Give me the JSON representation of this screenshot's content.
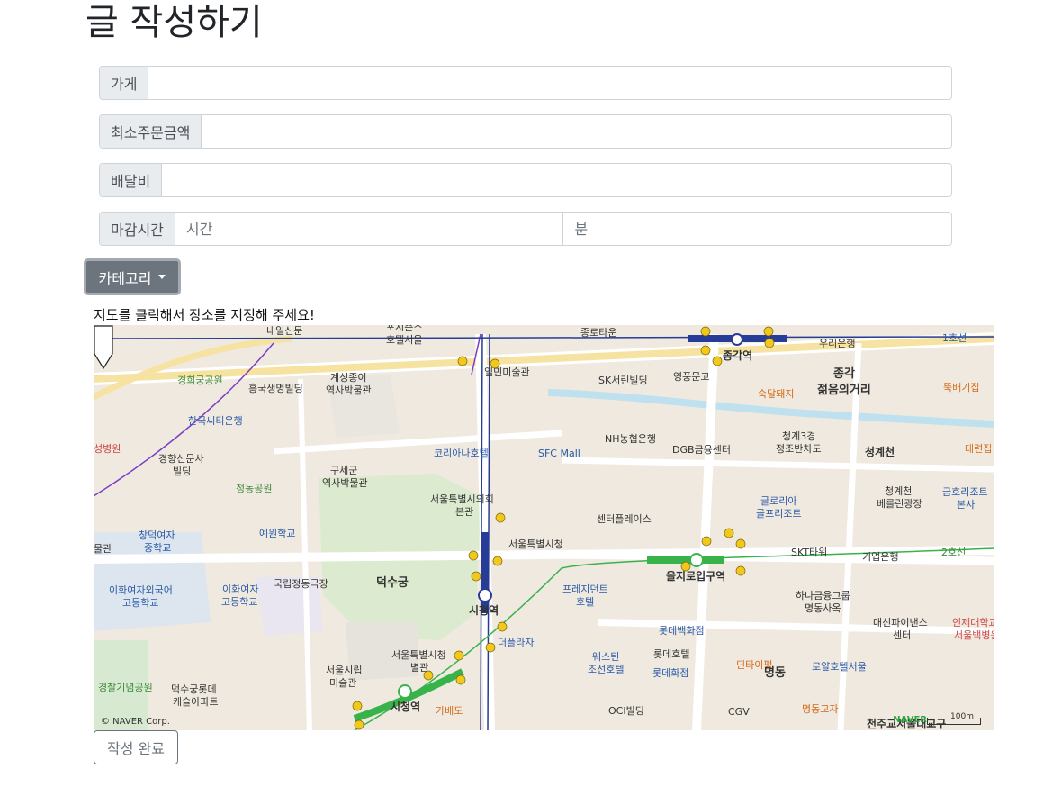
{
  "page": {
    "title": "글 작성하기"
  },
  "form": {
    "store": {
      "label": "가게",
      "value": ""
    },
    "min_order": {
      "label": "최소주문금액",
      "value": ""
    },
    "delivery_fee": {
      "label": "배달비",
      "value": ""
    },
    "deadline": {
      "label": "마감시간",
      "hour_placeholder": "시간",
      "minute_placeholder": "분"
    },
    "category_button": "카테고리",
    "map_hint": "지도를 클릭해서 장소를 지정해 주세요!",
    "submit_label": "작성 완료"
  },
  "map": {
    "copyright": "© NAVER Corp.",
    "logo": "NAVER",
    "scale": "100m",
    "labels": [
      {
        "text": "내일신문",
        "style": ""
      },
      {
        "text": "포시즌스",
        "style": ""
      },
      {
        "text": "호텔서울",
        "style": ""
      },
      {
        "text": "종로타운",
        "style": ""
      },
      {
        "text": "종각역",
        "style": "bold"
      },
      {
        "text": "우리은행",
        "style": ""
      },
      {
        "text": "1호선",
        "style": "blue"
      },
      {
        "text": "일민미술관",
        "style": ""
      },
      {
        "text": "경희궁공원",
        "style": "green"
      },
      {
        "text": "계성종이",
        "style": ""
      },
      {
        "text": "역사박물관",
        "style": ""
      },
      {
        "text": "흥국생명빌딩",
        "style": ""
      },
      {
        "text": "SK서린빌딩",
        "style": ""
      },
      {
        "text": "영풍문고",
        "style": ""
      },
      {
        "text": "숙달돼지",
        "style": "orange"
      },
      {
        "text": "종각",
        "style": "big"
      },
      {
        "text": "젊음의거리",
        "style": "big"
      },
      {
        "text": "뚝배기집",
        "style": "orange"
      },
      {
        "text": "한국씨티은행",
        "style": "blue"
      },
      {
        "text": "NH농협은행",
        "style": ""
      },
      {
        "text": "청계3경",
        "style": ""
      },
      {
        "text": "정조반차도",
        "style": ""
      },
      {
        "text": "성병원",
        "style": "red"
      },
      {
        "text": "코리아나호텔",
        "style": "blue"
      },
      {
        "text": "SFC Mall",
        "style": "blue"
      },
      {
        "text": "DGB금융센터",
        "style": ""
      },
      {
        "text": "청계천",
        "style": "bold"
      },
      {
        "text": "대련집",
        "style": "orange"
      },
      {
        "text": "경향신문사",
        "style": ""
      },
      {
        "text": "빌딩",
        "style": ""
      },
      {
        "text": "구세군",
        "style": ""
      },
      {
        "text": "역사박물관",
        "style": ""
      },
      {
        "text": "정동공원",
        "style": "green"
      },
      {
        "text": "서울특별시의회",
        "style": ""
      },
      {
        "text": "본관",
        "style": ""
      },
      {
        "text": "글로리아",
        "style": "blue"
      },
      {
        "text": "골프리조트",
        "style": "blue"
      },
      {
        "text": "청계천",
        "style": ""
      },
      {
        "text": "베를린광장",
        "style": ""
      },
      {
        "text": "금호리조트",
        "style": "blue"
      },
      {
        "text": "본사",
        "style": "blue"
      },
      {
        "text": "창덕여자",
        "style": "blue"
      },
      {
        "text": "중학교",
        "style": "blue"
      },
      {
        "text": "예원학교",
        "style": "blue"
      },
      {
        "text": "센터플레이스",
        "style": ""
      },
      {
        "text": "서울특별시청",
        "style": ""
      },
      {
        "text": "SKT타워",
        "style": ""
      },
      {
        "text": "기업은행",
        "style": ""
      },
      {
        "text": "2호선",
        "style": "green"
      },
      {
        "text": "물관",
        "style": ""
      },
      {
        "text": "국립정동극장",
        "style": ""
      },
      {
        "text": "덕수궁",
        "style": "big"
      },
      {
        "text": "을지로입구역",
        "style": "bold"
      },
      {
        "text": "이화여자외국어",
        "style": "blue"
      },
      {
        "text": "고등학교",
        "style": "blue"
      },
      {
        "text": "이화여자",
        "style": "blue"
      },
      {
        "text": "고등학교",
        "style": "blue"
      },
      {
        "text": "프레지던트",
        "style": "blue"
      },
      {
        "text": "호텔",
        "style": "blue"
      },
      {
        "text": "하나금융그룹",
        "style": ""
      },
      {
        "text": "명동사옥",
        "style": ""
      },
      {
        "text": "시청역",
        "style": "bold"
      },
      {
        "text": "더플라자",
        "style": "blue"
      },
      {
        "text": "롯데백화점",
        "style": "blue"
      },
      {
        "text": "대신파이낸스",
        "style": ""
      },
      {
        "text": "센터",
        "style": ""
      },
      {
        "text": "인제대학교",
        "style": "red"
      },
      {
        "text": "서울백병원",
        "style": "red"
      },
      {
        "text": "서울특별시청",
        "style": ""
      },
      {
        "text": "별관",
        "style": ""
      },
      {
        "text": "서울시립",
        "style": ""
      },
      {
        "text": "미술관",
        "style": ""
      },
      {
        "text": "웨스틴",
        "style": "blue"
      },
      {
        "text": "조선호텔",
        "style": "blue"
      },
      {
        "text": "롯데호텔",
        "style": ""
      },
      {
        "text": "롯데화점",
        "style": "blue"
      },
      {
        "text": "딘타이펑",
        "style": "orange"
      },
      {
        "text": "명동",
        "style": "big"
      },
      {
        "text": "로얄호텔서울",
        "style": "blue"
      },
      {
        "text": "경찰기념공원",
        "style": "green"
      },
      {
        "text": "덕수궁롯데",
        "style": ""
      },
      {
        "text": "캐슬아파트",
        "style": ""
      },
      {
        "text": "시청역",
        "style": "bold"
      },
      {
        "text": "가배도",
        "style": "orange"
      },
      {
        "text": "OCI빌딩",
        "style": ""
      },
      {
        "text": "CGV",
        "style": ""
      },
      {
        "text": "명동교자",
        "style": "orange"
      },
      {
        "text": "천주교서울대교구",
        "style": "bold"
      }
    ]
  }
}
